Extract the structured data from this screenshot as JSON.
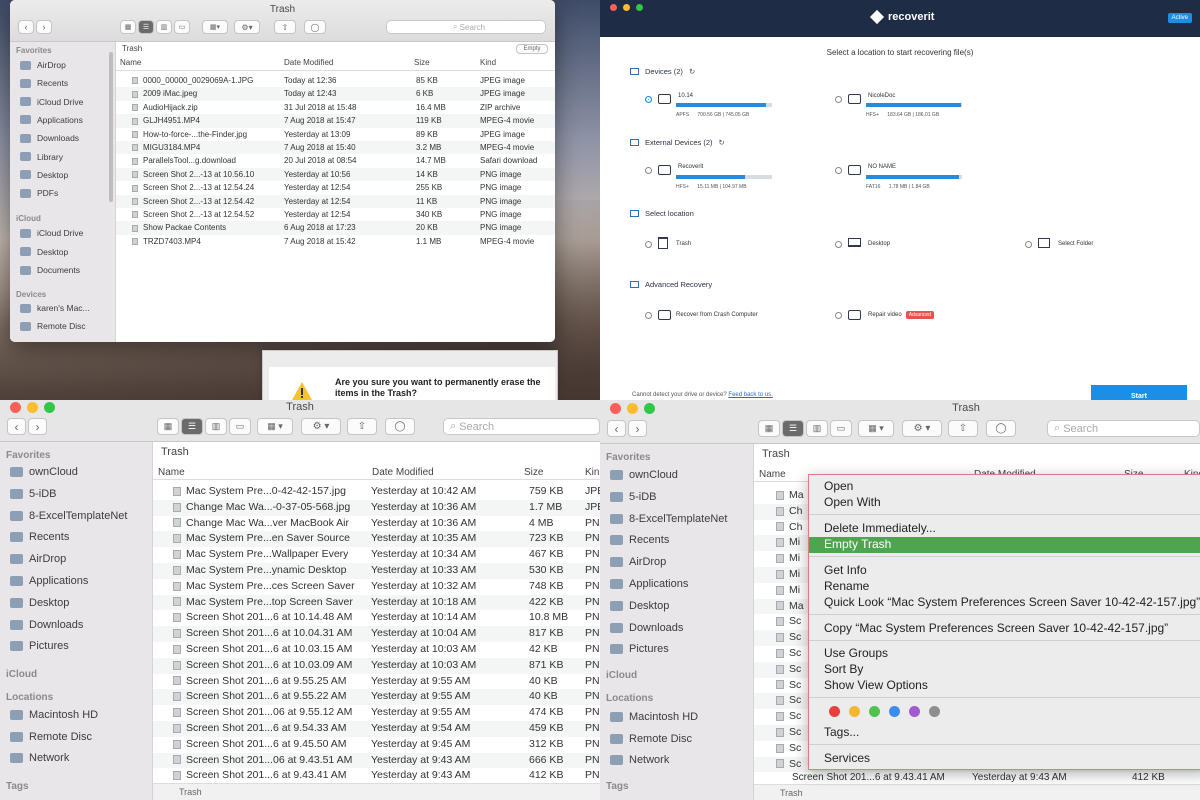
{
  "q1": {
    "title": "Trash",
    "search": "Search",
    "path": "Trash",
    "empty": "Empty",
    "cols": [
      "Name",
      "Date Modified",
      "Size",
      "Kind"
    ],
    "sidebar": {
      "h_fav": "Favorites",
      "fav": [
        "AirDrop",
        "Recents",
        "iCloud Drive",
        "Applications",
        "Downloads",
        "Library",
        "Desktop",
        "PDFs"
      ],
      "h_icloud": "iCloud",
      "icloud": [
        "iCloud Drive",
        "Desktop",
        "Documents"
      ],
      "h_dev": "Devices",
      "dev": [
        "karen's Mac...",
        "Remote Disc"
      ]
    },
    "rows": [
      [
        "0000_00000_0029069A-1.JPG",
        "Today at 12:36",
        "85 KB",
        "JPEG image"
      ],
      [
        "2009 iMac.jpeg",
        "Today at 12:43",
        "6 KB",
        "JPEG image"
      ],
      [
        "AudioHijack.zip",
        "31 Jul 2018 at 15:48",
        "16.4 MB",
        "ZIP archive"
      ],
      [
        "GLJH4951.MP4",
        "7 Aug 2018 at 15:47",
        "119 KB",
        "MPEG-4 movie"
      ],
      [
        "How-to-force-...the-Finder.jpg",
        "Yesterday at 13:09",
        "89 KB",
        "JPEG image"
      ],
      [
        "MIGU3184.MP4",
        "7 Aug 2018 at 15:40",
        "3.2 MB",
        "MPEG-4 movie"
      ],
      [
        "ParallelsTool...g.download",
        "20 Jul 2018 at 08:54",
        "14.7 MB",
        "Safari download"
      ],
      [
        "Screen Shot 2...-13 at 10.56.10",
        "Yesterday at 10:56",
        "14 KB",
        "PNG image"
      ],
      [
        "Screen Shot 2...-13 at 12.54.24",
        "Yesterday at 12:54",
        "255 KB",
        "PNG image"
      ],
      [
        "Screen Shot 2...-13 at 12.54.42",
        "Yesterday at 12:54",
        "11 KB",
        "PNG image"
      ],
      [
        "Screen Shot 2...-13 at 12.54.52",
        "Yesterday at 12:54",
        "340 KB",
        "PNG image"
      ],
      [
        "Show Packae Contents",
        "6 Aug 2018 at 17:23",
        "20 KB",
        "PNG image"
      ],
      [
        "TRZD7403.MP4",
        "7 Aug 2018 at 15:42",
        "1.1 MB",
        "MPEG-4 movie"
      ]
    ],
    "dialog": "Are you sure you want to permanently erase the items in the Trash?"
  },
  "q2": {
    "brand": "recoverit",
    "active": "Active",
    "heading": "Select a location to start recovering file(s)",
    "devices": "Devices (2)",
    "d1": {
      "name": "10.14",
      "fs": "APFS",
      "used": "700.56 GB | 745.05 GB",
      "fill": 0.94
    },
    "d2": {
      "name": "NicoleDoc",
      "fs": "HFS+",
      "used": "183.64 GB | 186.01 GB",
      "fill": 0.99
    },
    "external": "External Devices (2)",
    "e1": {
      "name": "Recoverit",
      "fs": "HFS+",
      "used": "15.11 MB | 104.97 MB",
      "fill": 0.72
    },
    "e2": {
      "name": "NO NAME",
      "fs": "FAT16",
      "used": "1.78 MB | 1.84 GB",
      "fill": 0.97
    },
    "selloc": "Select location",
    "locs": [
      "Trash",
      "Desktop",
      "Select Folder"
    ],
    "adv": "Advanced Recovery",
    "advopts": [
      "Recover from Crash Computer",
      "Repair video"
    ],
    "advbadge": "Advanced",
    "footer": "Cannot detect your drive or device?",
    "footerlink": "Feed back to us.",
    "start": "Start"
  },
  "q3": {
    "title": "Trash",
    "search": "Search",
    "path": "Trash",
    "bottompath": "Trash",
    "cols": [
      "Name",
      "Date Modified",
      "Size",
      "Kin"
    ],
    "sidebar": {
      "h_fav": "Favorites",
      "fav": [
        "ownCloud",
        "5-iDB",
        "8-ExcelTemplateNet",
        "Recents",
        "AirDrop",
        "Applications",
        "Desktop",
        "Downloads",
        "Pictures"
      ],
      "h_icloud": "iCloud",
      "h_loc": "Locations",
      "loc": [
        "Macintosh HD",
        "Remote Disc",
        "Network"
      ],
      "h_tags": "Tags"
    },
    "rows": [
      [
        "Mac System Pre...0-42-42-157.jpg",
        "Yesterday at 10:42 AM",
        "759 KB",
        "JPE"
      ],
      [
        "Change Mac Wa...-0-37-05-568.jpg",
        "Yesterday at 10:36 AM",
        "1.7 MB",
        "JPE"
      ],
      [
        "Change Mac Wa...ver MacBook Air",
        "Yesterday at 10:36 AM",
        "4 MB",
        "PNG"
      ],
      [
        "Mac System Pre...en Saver Source",
        "Yesterday at 10:35 AM",
        "723 KB",
        "PNG"
      ],
      [
        "Mac System Pre...Wallpaper Every",
        "Yesterday at 10:34 AM",
        "467 KB",
        "PNG"
      ],
      [
        "Mac System Pre...ynamic Desktop",
        "Yesterday at 10:33 AM",
        "530 KB",
        "PNG"
      ],
      [
        "Mac System Pre...ces Screen Saver",
        "Yesterday at 10:32 AM",
        "748 KB",
        "PNG"
      ],
      [
        "Mac System Pre...top Screen Saver",
        "Yesterday at 10:18 AM",
        "422 KB",
        "PNG"
      ],
      [
        "Screen Shot 201...6 at 10.14.48 AM",
        "Yesterday at 10:14 AM",
        "10.8 MB",
        "PNG"
      ],
      [
        "Screen Shot 201...6 at 10.04.31 AM",
        "Yesterday at 10:04 AM",
        "817 KB",
        "PNG"
      ],
      [
        "Screen Shot 201...6 at 10.03.15 AM",
        "Yesterday at 10:03 AM",
        "42 KB",
        "PNG"
      ],
      [
        "Screen Shot 201...6 at 10.03.09 AM",
        "Yesterday at 10:03 AM",
        "871 KB",
        "PNG"
      ],
      [
        "Screen Shot 201...6 at 9.55.25 AM",
        "Yesterday at 9:55 AM",
        "40 KB",
        "PNG"
      ],
      [
        "Screen Shot 201...6 at 9.55.22 AM",
        "Yesterday at 9:55 AM",
        "40 KB",
        "PNG"
      ],
      [
        "Screen Shot 201...06 at 9.55.12 AM",
        "Yesterday at 9:55 AM",
        "474 KB",
        "PNG"
      ],
      [
        "Screen Shot 201...6 at 9.54.33 AM",
        "Yesterday at 9:54 AM",
        "459 KB",
        "PNG"
      ],
      [
        "Screen Shot 201...6 at 9.45.50 AM",
        "Yesterday at 9:45 AM",
        "312 KB",
        "PNG"
      ],
      [
        "Screen Shot 201...06 at 9.43.51 AM",
        "Yesterday at 9:43 AM",
        "666 KB",
        "PNG"
      ],
      [
        "Screen Shot 201...6 at 9.43.41 AM",
        "Yesterday at 9:43 AM",
        "412 KB",
        "PNG"
      ]
    ]
  },
  "q4": {
    "title": "Trash",
    "search": "Search",
    "path": "Trash",
    "bottompath": "Trash",
    "cols": [
      "Name",
      "Date Modified",
      "Size",
      "Kind"
    ],
    "sidebar": {
      "h_fav": "Favorites",
      "fav": [
        "ownCloud",
        "5-iDB",
        "8-ExcelTemplateNet",
        "Recents",
        "AirDrop",
        "Applications",
        "Desktop",
        "Downloads",
        "Pictures"
      ],
      "h_icloud": "iCloud",
      "h_loc": "Locations",
      "loc": [
        "Macintosh HD",
        "Remote Disc",
        "Network"
      ],
      "h_tags": "Tags"
    },
    "rowstubs": [
      "Ma",
      "Ch",
      "Ch",
      "Mi",
      "Mi",
      "Mi",
      "Mi",
      "Ma",
      "Sc",
      "Sc",
      "Sc",
      "Sc",
      "Sc",
      "Sc",
      "Sc",
      "Sc",
      "Sc",
      "Sc"
    ],
    "lastrow": [
      "Screen Shot 201...6 at 9.43.41 AM",
      "Yesterday at 9:43 AM",
      "412 KB"
    ],
    "menu": {
      "open": "Open",
      "openwith": "Open With",
      "delete": "Delete Immediately...",
      "empty": "Empty Trash",
      "info": "Get Info",
      "rename": "Rename",
      "quicklook": "Quick Look “Mac System Preferences Screen Saver 10-42-42-157.jpg”",
      "copy": "Copy “Mac System Preferences Screen Saver 10-42-42-157.jpg”",
      "groups": "Use Groups",
      "sortby": "Sort By",
      "viewopts": "Show View Options",
      "tags": "Tags...",
      "services": "Services"
    },
    "tagcolors": [
      "#e5413e",
      "#f3b731",
      "#4fc34e",
      "#3c8cf0",
      "#a25ad3",
      "#8e8e8e"
    ]
  }
}
